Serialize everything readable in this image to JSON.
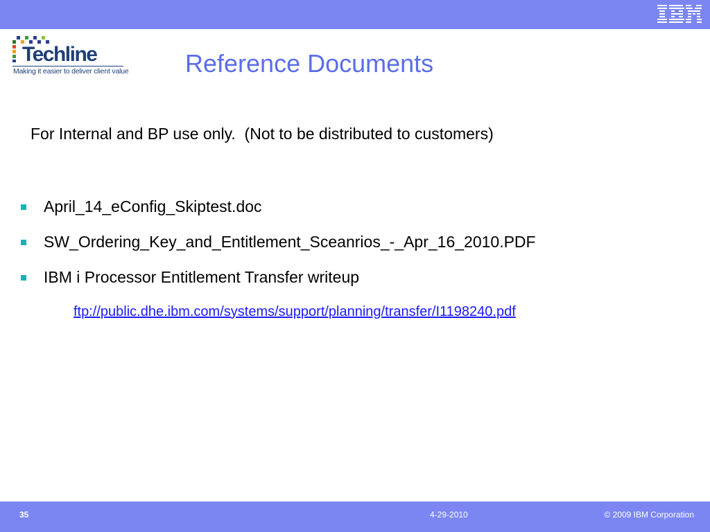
{
  "header": {
    "brand_logo": "IBM",
    "logo_name": "Techline",
    "logo_tagline": "Making it easier to deliver client value"
  },
  "slide": {
    "title": "Reference Documents",
    "subtitle": "For Internal and BP use only.  (Not to be distributed to customers)",
    "bullets": [
      "April_14_eConfig_Skiptest.doc",
      "SW_Ordering_Key_and_Entitlement_Sceanrios_-_Apr_16_2010.PDF",
      "IBM i Processor Entitlement Transfer writeup"
    ],
    "link": "ftp://public.dhe.ibm.com/systems/support/planning/transfer/I1198240.pdf"
  },
  "footer": {
    "page_number": "35",
    "date": "4-29-2010",
    "copyright": "© 2009 IBM Corporation"
  },
  "colors": {
    "bar": "#7b86f2",
    "title": "#5b6ee8",
    "bullet": "#17b3b3",
    "link": "#1a1aff",
    "logo": "#1f3f7a"
  }
}
